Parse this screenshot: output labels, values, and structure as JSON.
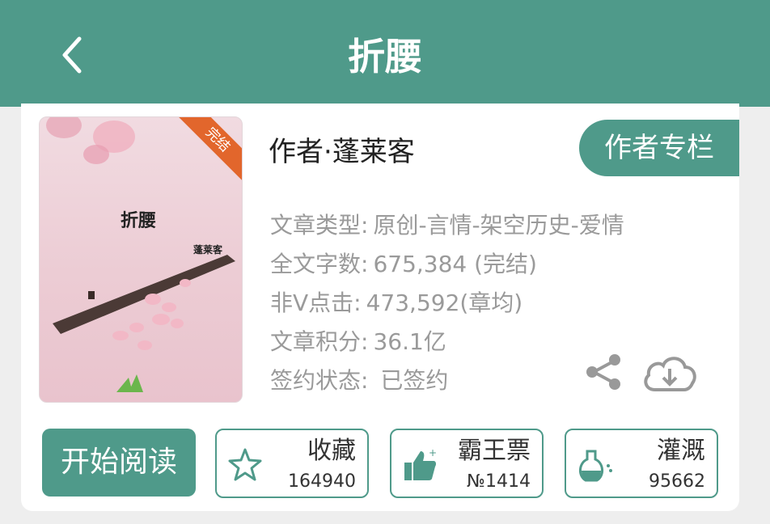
{
  "header": {
    "title": "折腰",
    "back_icon": "chevron-left-icon"
  },
  "book": {
    "cover": {
      "title": "折腰",
      "author": "蓬莱客",
      "badge": "完结"
    },
    "author_line": "作者·蓬莱客",
    "author_column_button": "作者专栏",
    "info": [
      {
        "label": "文章类型:",
        "value": "原创-言情-架空历史-爱情"
      },
      {
        "label": "全文字数:",
        "value": "675,384 (完结)"
      },
      {
        "label": "非V点击:",
        "value": "473,592(章均)"
      },
      {
        "label": "文章积分:",
        "value": "36.1亿"
      },
      {
        "label": "签约状态:",
        "value": " 已签约"
      }
    ]
  },
  "actions": {
    "read_button": "开始阅读",
    "favorite": {
      "label": "收藏",
      "count": "164940",
      "icon": "star-icon"
    },
    "vote": {
      "label": "霸王票",
      "count": "№1414",
      "icon": "thumbs-up-icon"
    },
    "irrigate": {
      "label": "灌溉",
      "count": "95662",
      "icon": "watering-flask-icon"
    }
  },
  "colors": {
    "accent": "#4f9a8a",
    "badge": "#e2662c"
  }
}
